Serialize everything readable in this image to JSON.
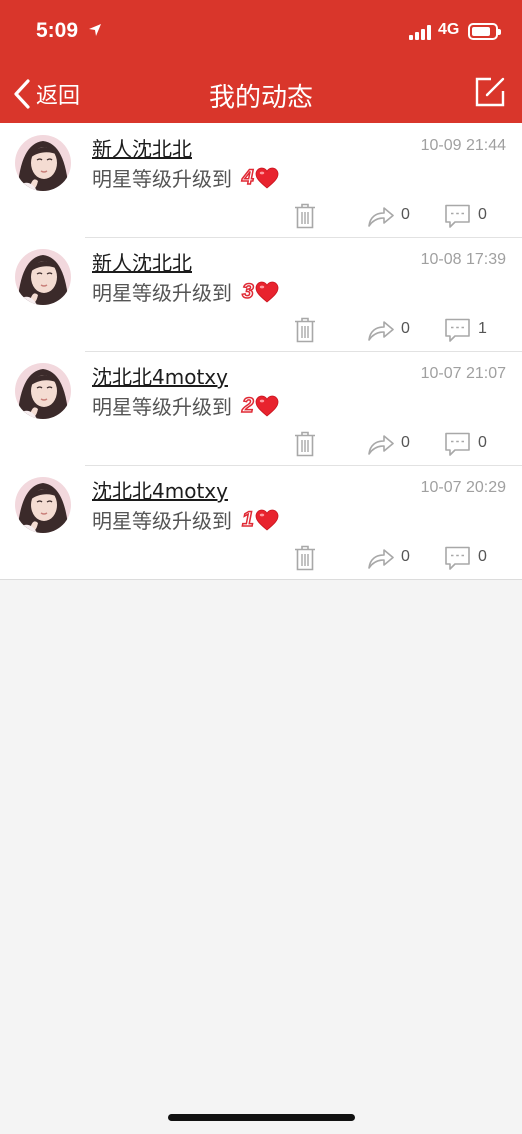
{
  "status_bar": {
    "time": "5:09",
    "network": "4G"
  },
  "navbar": {
    "back_label": "返回",
    "title": "我的动态"
  },
  "feed": [
    {
      "name": "新人沈北北",
      "timestamp": "10-09 21:44",
      "message": "明星等级升级到",
      "level": "4",
      "share_count": "0",
      "comment_count": "0"
    },
    {
      "name": "新人沈北北",
      "timestamp": "10-08 17:39",
      "message": "明星等级升级到",
      "level": "3",
      "share_count": "0",
      "comment_count": "1"
    },
    {
      "name": "沈北北4motxy",
      "timestamp": "10-07 21:07",
      "message": "明星等级升级到",
      "level": "2",
      "share_count": "0",
      "comment_count": "0"
    },
    {
      "name": "沈北北4motxy",
      "timestamp": "10-07 20:29",
      "message": "明星等级升级到",
      "level": "1",
      "share_count": "0",
      "comment_count": "0"
    }
  ],
  "colors": {
    "brand": "#d9362b",
    "heart": "#e8232e"
  },
  "icons": [
    "back-chevron-icon",
    "edit-icon",
    "trash-icon",
    "share-icon",
    "comment-icon",
    "heart-icon"
  ]
}
